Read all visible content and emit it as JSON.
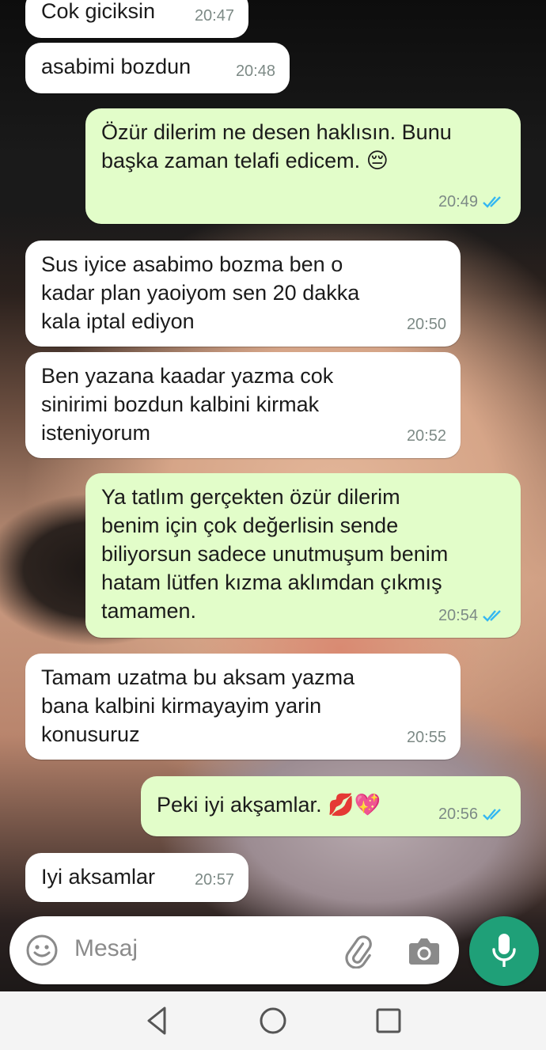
{
  "messages": [
    {
      "dir": "in",
      "text": "Cok giciksin",
      "time": "20:47"
    },
    {
      "dir": "in",
      "text": "asabimi bozdun",
      "time": "20:48"
    },
    {
      "dir": "out",
      "text": "Özür dilerim ne desen haklısın. Bunu\nbaşka zaman telafi edicem.",
      "emoji": "😔",
      "time": "20:49",
      "status": "read"
    },
    {
      "dir": "in",
      "text": "Sus iyice asabimo bozma ben o\nkadar plan yaoiyom sen 20 dakka\nkala iptal ediyon",
      "time": "20:50"
    },
    {
      "dir": "in",
      "text": "Ben yazana kaadar yazma cok\nsinirimi bozdun kalbini kirmak\nisteniyorum",
      "time": "20:52"
    },
    {
      "dir": "out",
      "text": "Ya tatlım gerçekten özür dilerim\nbenim için çok değerlisin sende\nbiliyorsun sadece unutmuşum benim\nhatam lütfen kızma aklımdan çıkmış\ntamamen.",
      "time": "20:54",
      "status": "read"
    },
    {
      "dir": "in",
      "text": "Tamam uzatma bu aksam yazma\nbana kalbini kirmayayim yarin\nkonusuruz",
      "time": "20:55"
    },
    {
      "dir": "out",
      "text": "Peki iyi akşamlar.",
      "emoji": "💋💖",
      "time": "20:56",
      "status": "read"
    },
    {
      "dir": "in",
      "text": "Iyi aksamlar",
      "time": "20:57"
    }
  ],
  "composer": {
    "placeholder": "Mesaj",
    "emoji_icon": "smiley-icon",
    "attach_icon": "paperclip-icon",
    "camera_icon": "camera-icon",
    "mic_icon": "microphone-icon"
  },
  "nav": {
    "back_icon": "back-triangle-icon",
    "home_icon": "home-circle-icon",
    "recents_icon": "recents-square-icon"
  },
  "colors": {
    "incoming_bubble": "#ffffff",
    "outgoing_bubble": "#e2fdc9",
    "read_ticks": "#34b7f1",
    "mic_button": "#1fa078"
  }
}
